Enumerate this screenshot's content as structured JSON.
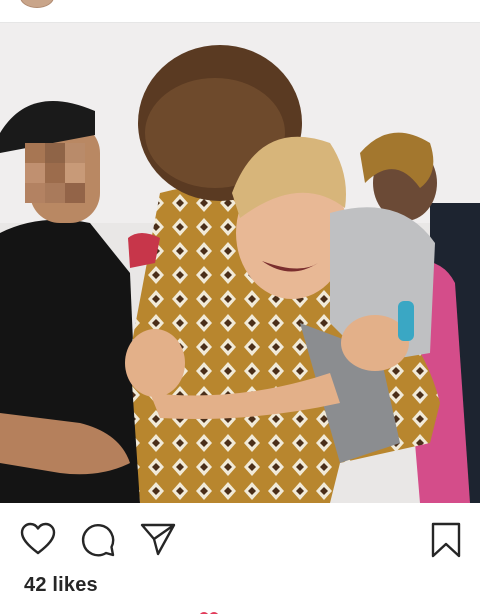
{
  "post": {
    "likes_text": "42 likes"
  },
  "photo": {
    "description_icon": "photo"
  },
  "actions": {
    "like_icon": "heart-icon",
    "comment_icon": "comment-icon",
    "share_icon": "send-icon",
    "save_icon": "bookmark-icon"
  },
  "colors": {
    "text": "#262626",
    "divider": "#e6e6e6",
    "background": "#ffffff"
  }
}
